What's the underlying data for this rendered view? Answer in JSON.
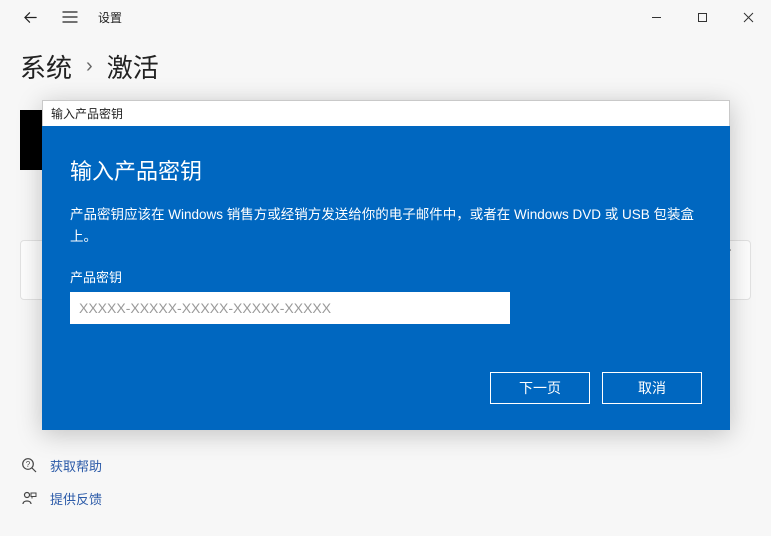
{
  "titlebar": {
    "app_title": "设置"
  },
  "breadcrumb": {
    "root": "系统",
    "separator": "›",
    "current": "激活"
  },
  "dialog": {
    "window_title": "输入产品密钥",
    "heading": "输入产品密钥",
    "description": "产品密钥应该在 Windows 销售方或经销方发送给你的电子邮件中，或者在 Windows DVD 或 USB 包装盒上。",
    "field_label": "产品密钥",
    "placeholder": "XXXXX-XXXXX-XXXXX-XXXXX-XXXXX",
    "next_label": "下一页",
    "cancel_label": "取消"
  },
  "footer": {
    "help_label": "获取帮助",
    "feedback_label": "提供反馈"
  }
}
